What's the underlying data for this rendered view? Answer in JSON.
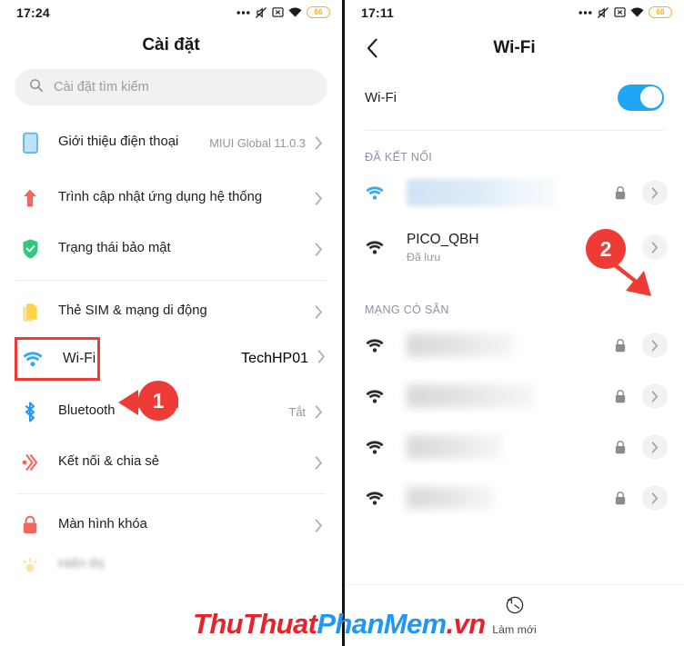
{
  "colors": {
    "accent_blue": "#21a6f5",
    "annotation_red": "#ef3b36",
    "battery_amber": "#f0b429",
    "section_label": "#8c93a8",
    "watermark_red": "#e8212b",
    "watermark_blue": "#2196f3"
  },
  "left_screen": {
    "status_bar": {
      "clock": "17:24",
      "battery_level": "66",
      "icons": [
        "more-dots-icon",
        "mute-icon",
        "sim-x-icon",
        "wifi-icon",
        "battery-icon"
      ]
    },
    "title": "Cài đặt",
    "search": {
      "placeholder": "Cài đặt tìm kiếm",
      "icon": "search-icon"
    },
    "items": [
      {
        "label": "Giới thiệu điện thoại",
        "value": "MIUI Global 11.0.3",
        "icon": "phone-info-icon"
      },
      {
        "label": "Trình cập nhật ứng dụng hệ thống",
        "value": "",
        "icon": "update-arrow-icon"
      },
      {
        "label": "Trạng thái bảo mật",
        "value": "",
        "icon": "shield-check-icon"
      },
      {
        "label": "Thẻ SIM & mạng di động",
        "value": "",
        "icon": "sim-card-icon"
      },
      {
        "label": "Wi-Fi",
        "value": "TechHP01",
        "icon": "wifi-icon"
      },
      {
        "label": "Bluetooth",
        "value": "Tắt",
        "icon": "bluetooth-icon"
      },
      {
        "label": "Kết nối & chia sẻ",
        "value": "",
        "icon": "share-connect-icon"
      },
      {
        "label": "Màn hình khóa",
        "value": "",
        "icon": "lock-icon"
      },
      {
        "label": "Hiển thị",
        "value": "",
        "icon": "brightness-icon"
      }
    ]
  },
  "right_screen": {
    "status_bar": {
      "clock": "17:11",
      "battery_level": "68",
      "icons": [
        "more-dots-icon",
        "mute-icon",
        "sim-x-icon",
        "wifi-icon",
        "battery-icon"
      ]
    },
    "title": "Wi-Fi",
    "back_icon": "back-chevron-icon",
    "toggle": {
      "label": "Wi-Fi",
      "state": "on"
    },
    "connected_section": {
      "header": "ĐÃ KẾT NỐI",
      "networks": [
        {
          "ssid": "",
          "sub": "",
          "blurred": true,
          "locked": true
        },
        {
          "ssid": "PICO_QBH",
          "sub": "Đã lưu",
          "blurred": false,
          "locked": true
        }
      ]
    },
    "available_section": {
      "header": "MẠNG CÓ SẴN",
      "networks": [
        {
          "ssid": "",
          "sub": "",
          "blurred": true,
          "locked": true
        },
        {
          "ssid": "",
          "sub": "",
          "blurred": true,
          "locked": true
        },
        {
          "ssid": "",
          "sub": "",
          "blurred": true,
          "locked": true
        },
        {
          "ssid": "",
          "sub": "",
          "blurred": true,
          "locked": true
        }
      ]
    },
    "refresh": {
      "label": "Làm mới",
      "icon": "refresh-clock-icon"
    }
  },
  "annotations": [
    {
      "number": "1",
      "target": "wifi-settings-row"
    },
    {
      "number": "2",
      "target": "pico-qbh-detail-arrow"
    }
  ],
  "watermark": {
    "part1": "ThuThuat",
    "part2": "PhanMem",
    "part3": ".vn"
  }
}
